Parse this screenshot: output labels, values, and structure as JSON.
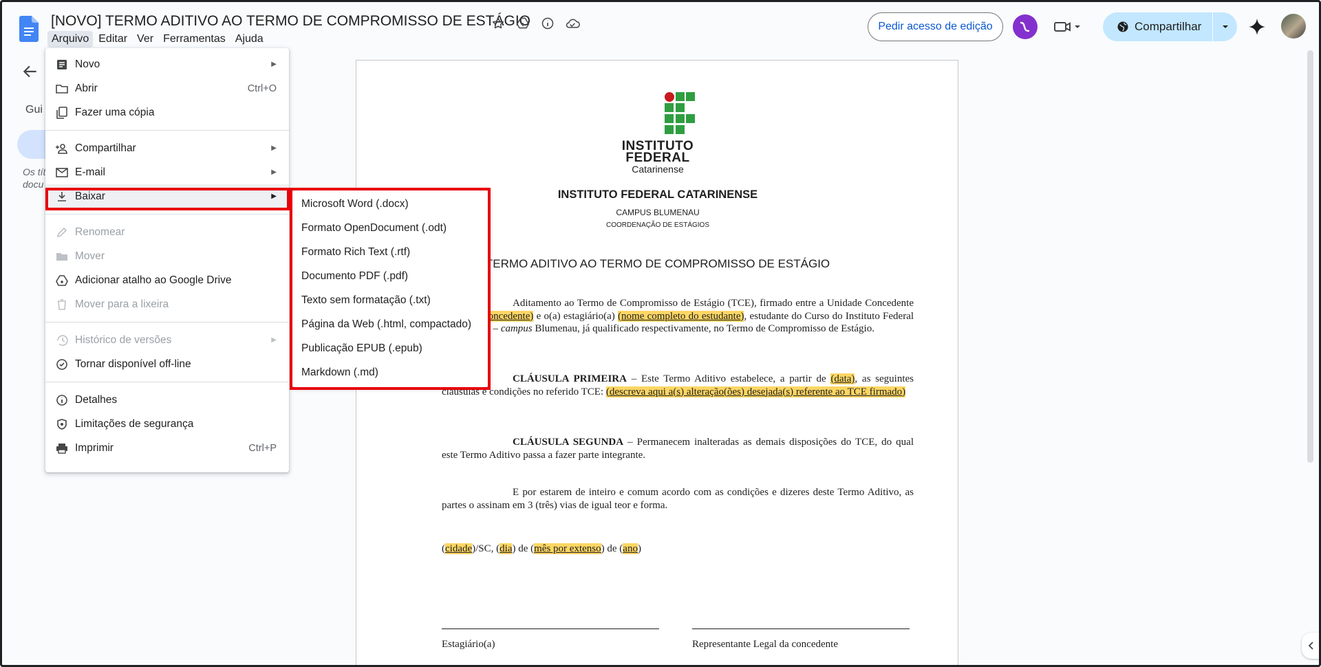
{
  "app": {
    "doc_title": "[NOVO] TERMO ADITIVO AO TERMO DE COMPROMISSO DE ESTÁGIO",
    "menus": [
      "Arquivo",
      "Editar",
      "Ver",
      "Ferramentas",
      "Ajuda"
    ],
    "request_edit_label": "Pedir acesso de edição",
    "share_label": "Compartilhar",
    "accent_color": "#0b57d0",
    "share_bg": "#c2e7ff"
  },
  "left_panel": {
    "outline_label": "Gui",
    "note": "Os tít docu"
  },
  "file_menu": {
    "items": [
      {
        "label": "Novo",
        "icon": "doc-icon",
        "shortcut": "",
        "submenu": true,
        "disabled": false
      },
      {
        "label": "Abrir",
        "icon": "folder-icon",
        "shortcut": "Ctrl+O",
        "submenu": false,
        "disabled": false
      },
      {
        "label": "Fazer uma cópia",
        "icon": "copy-icon",
        "shortcut": "",
        "submenu": false,
        "disabled": false
      },
      {
        "label": "Compartilhar",
        "icon": "person-add-icon",
        "shortcut": "",
        "submenu": true,
        "disabled": false
      },
      {
        "label": "E-mail",
        "icon": "mail-icon",
        "shortcut": "",
        "submenu": true,
        "disabled": false
      },
      {
        "label": "Baixar",
        "icon": "download-icon",
        "shortcut": "",
        "submenu": true,
        "disabled": false,
        "selected": true
      },
      {
        "label": "Renomear",
        "icon": "pencil-icon",
        "shortcut": "",
        "submenu": false,
        "disabled": true
      },
      {
        "label": "Mover",
        "icon": "move-folder-icon",
        "shortcut": "",
        "submenu": false,
        "disabled": true
      },
      {
        "label": "Adicionar atalho ao Google Drive",
        "icon": "drive-add-icon",
        "shortcut": "",
        "submenu": false,
        "disabled": false
      },
      {
        "label": "Mover para a lixeira",
        "icon": "trash-icon",
        "shortcut": "",
        "submenu": false,
        "disabled": true
      },
      {
        "label": "Histórico de versões",
        "icon": "history-icon",
        "shortcut": "",
        "submenu": true,
        "disabled": true
      },
      {
        "label": "Tornar disponível off-line",
        "icon": "offline-icon",
        "shortcut": "",
        "submenu": false,
        "disabled": false
      },
      {
        "label": "Detalhes",
        "icon": "info-icon",
        "shortcut": "",
        "submenu": false,
        "disabled": false
      },
      {
        "label": "Limitações de segurança",
        "icon": "shield-icon",
        "shortcut": "",
        "submenu": false,
        "disabled": false
      },
      {
        "label": "Imprimir",
        "icon": "printer-icon",
        "shortcut": "Ctrl+P",
        "submenu": false,
        "disabled": false
      }
    ]
  },
  "download_menu": {
    "items": [
      "Microsoft Word (.docx)",
      "Formato OpenDocument (.odt)",
      "Formato Rich Text (.rtf)",
      "Documento PDF (.pdf)",
      "Texto sem formatação (.txt)",
      "Página da Web (.html, compactado)",
      "Publicação EPUB (.epub)",
      "Markdown (.md)"
    ],
    "highlight_color": "#e8000b"
  },
  "document": {
    "logo_lines": [
      "INSTITUTO",
      "FEDERAL",
      "Catarinense"
    ],
    "header": [
      "INSTITUTO FEDERAL CATARINENSE",
      "CAMPUS BLUMENAU",
      "COORDENAÇÃO DE ESTÁGIOS"
    ],
    "title": "TERMO ADITIVO AO TERMO DE COMPROMISSO DE ESTÁGIO",
    "p1": {
      "a": "Aditamento ao Termo de Compromisso de Estágio (TCE), firmado entre a Unidade Concedente ",
      "b": "(nome da concedente)",
      "c": " e o(a) estagiário(a) ",
      "d": "(nome completo do estudante)",
      "e": ", estudante do Curso ",
      "f": " do Instituto Federal Catarinense – ",
      "g": "campus",
      "h": " Blumenau, já qualificado respectivamente, no Termo de Compromisso de Estágio."
    },
    "p2": {
      "a": "CLÁUSULA PRIMEIRA",
      "b": " – Este Termo Aditivo estabelece, a partir de ",
      "c": "(data)",
      "d": ", as seguintes cláusulas e condições no referido TCE: ",
      "e": "(descreva aqui a(s) alteração(ões) desejada(s) referente ao TCE firmado)"
    },
    "p3": {
      "a": "CLÁUSULA SEGUNDA",
      "b": " – Permanecem inalteradas as demais disposições do TCE, do qual este Termo Aditivo passa a fazer parte integrante."
    },
    "p4": "E por estarem de inteiro e comum acordo com as condições e dizeres deste Termo Aditivo, as partes o assinam em 3 (três) vias de igual teor e forma.",
    "p5": {
      "a": "(",
      "b": "cidade",
      "c": ")/SC, (",
      "d": "dia",
      "e": ") de (",
      "f": "mês por extenso",
      "g": ") de (",
      "h": "ano",
      "i": ")"
    },
    "signatures": [
      "Estagiário(a)",
      "Representante Legal da concedente"
    ],
    "highlight_color": "#fdd663"
  }
}
